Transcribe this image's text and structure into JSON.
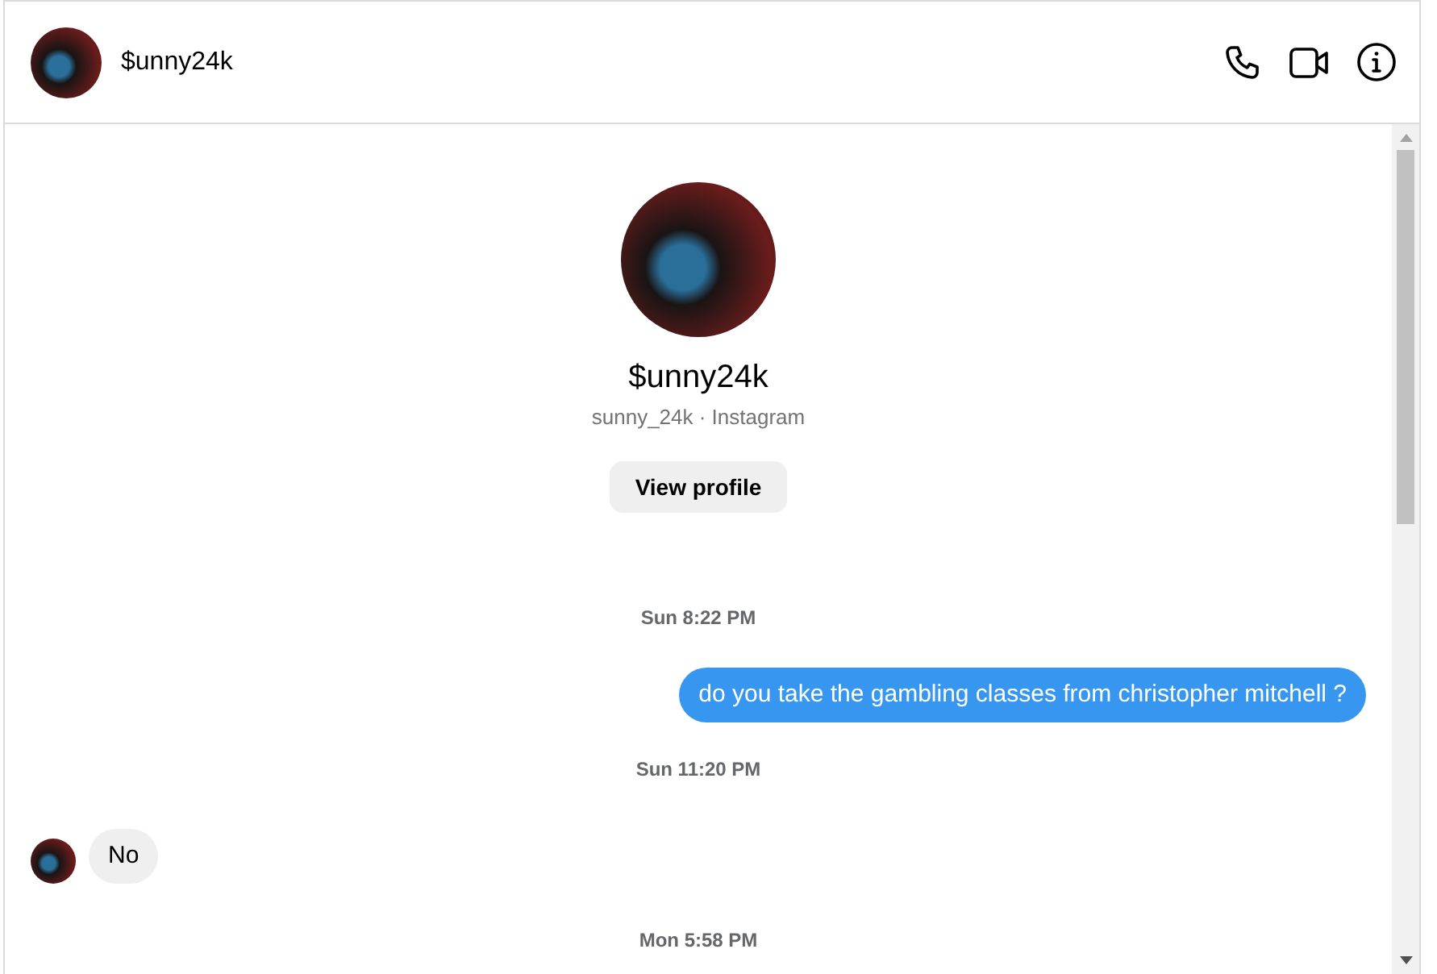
{
  "header": {
    "name": "$unny24k"
  },
  "profile": {
    "name": "$unny24k",
    "subtitle": "sunny_24k · Instagram",
    "button": "View profile"
  },
  "messages": [
    {
      "kind": "time",
      "text": "Sun 8:22 PM"
    },
    {
      "kind": "outgoing",
      "text": "do you take the gambling classes from christopher mitchell ?"
    },
    {
      "kind": "time",
      "text": "Sun 11:20 PM"
    },
    {
      "kind": "incoming",
      "text": "No"
    },
    {
      "kind": "time",
      "text": "Mon 5:58 PM"
    }
  ]
}
